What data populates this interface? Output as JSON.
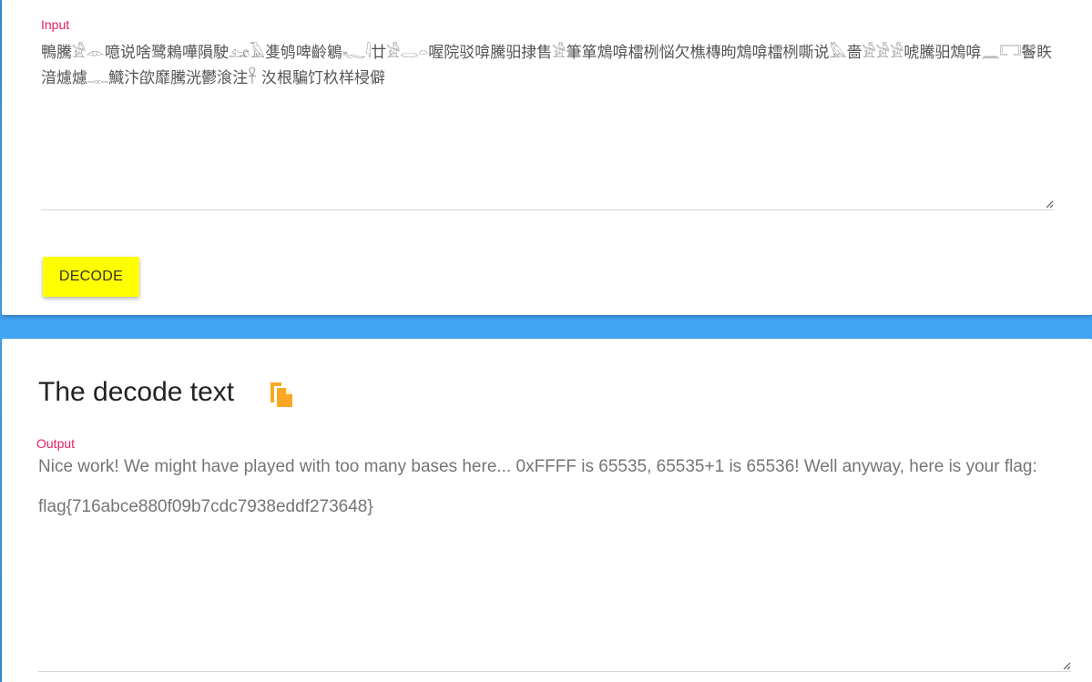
{
  "input_panel": {
    "label": "Input",
    "value": "鴨騰𓀀𓁹噫说啥鹭鵣嘩隕駛𓃭𓄿㕠鸲啤齡鵴𓆑𓇋廿𓀀𓂋𓏏喔院驳啽騰驲捸售𓀀筆箪鴆啽檑栵悩欠樵槫昫鴆啽檑栵嘶说𓅓嗇𓀀𓀀𓀀唬騰驲鴆啽𓈖𓉐鬠䀢湆爈爈𓊃鱵汴欿靡騰洸鬱湌注𓋹 汷根騙饤杦样梫僻",
    "decode_button_label": "DECODE"
  },
  "output_panel": {
    "title": "The decode text",
    "copy_icon": "copy-file-icon",
    "label": "Output",
    "value": "Nice work! We might have played with too many bases here... 0xFFFF is 65535, 65535+1 is 65536! Well anyway, here is your flag:\n\nflag{716abce880f09b7cdc7938eddf273648}"
  },
  "colors": {
    "background_blue": "#42a5f5",
    "label_pink": "#e91e63",
    "button_yellow": "#ffff00",
    "copy_icon_orange": "#f9a825"
  }
}
